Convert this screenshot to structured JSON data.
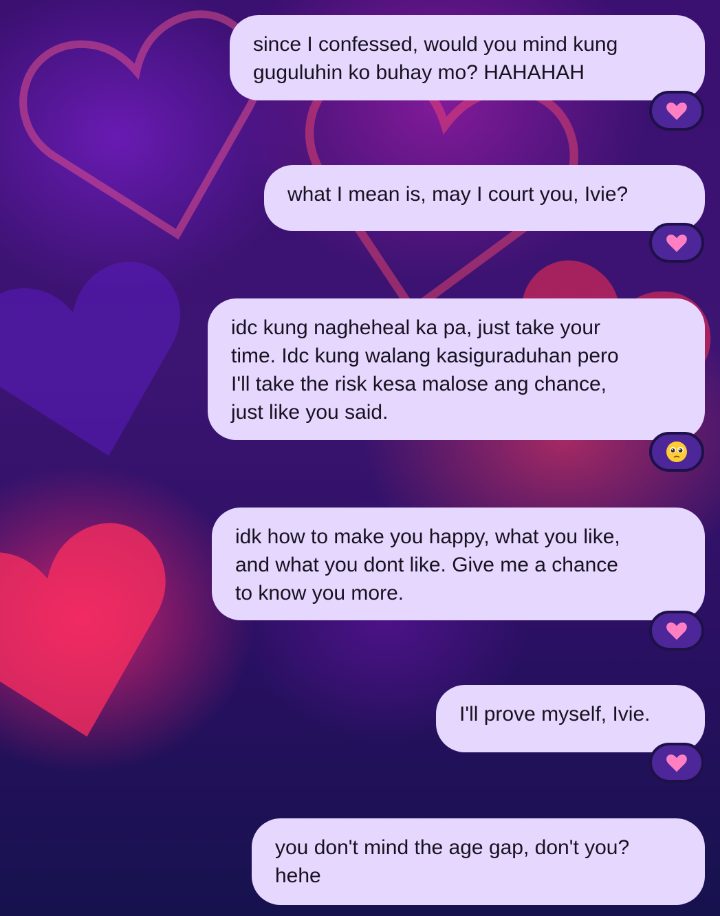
{
  "messages": [
    {
      "text": "since I confessed, would you mind kung\nguguluhin ko buhay mo? HAHAHAH",
      "reaction": "heart-emoji"
    },
    {
      "text": "what I mean is, may I court you, Ivie?",
      "reaction": "heart-emoji"
    },
    {
      "text": "idc kung nagheheal ka pa, just take your\ntime. Idc kung walang kasiguraduhan pero\nI'll take the risk kesa malose ang chance,\njust like you said.",
      "reaction": "pleading-face-emoji"
    },
    {
      "text": "idk how to make you happy, what you like,\nand what you dont like. Give me a chance\nto know you more.",
      "reaction": "heart-emoji"
    },
    {
      "text": "I'll prove myself, Ivie.",
      "reaction": "heart-emoji"
    },
    {
      "text": "you don't mind the age gap, don't you?\nhehe"
    }
  ],
  "colors": {
    "bubble": "#e6d7ff",
    "text": "#17121f",
    "reaction_pill": "#4d279a",
    "heart": "#ff7fc2",
    "background_dark": "#12104a"
  }
}
